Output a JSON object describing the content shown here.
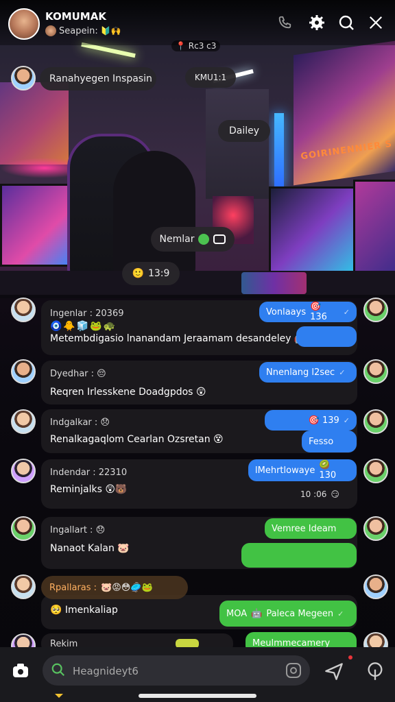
{
  "header": {
    "title": "KOMUMAK",
    "subtitle": "Seapein:",
    "subtitle_emojis": "🔰🙌",
    "phone_icon": "phone-icon",
    "gear_icon": "gear-icon",
    "search_icon": "search-icon",
    "close_icon": "close-icon"
  },
  "top_chip": "📍 Rc3 c3",
  "overlays": {
    "announce": "Ranahyegen Inspasin",
    "pill_right": "KMU1:1",
    "daley": "Dailey",
    "nemlar": "Nemlar",
    "time_chip": "13:9"
  },
  "poster_title": "GOIRINENNIER S",
  "messages": [
    {
      "name": "Ingenlar : 20369",
      "emoji_row": "🧿🐥🧊🐸🐢",
      "text": "Metembdigasio lnanandam Jeraamam desandeley 🤖🤯",
      "reply": "Vonlaays",
      "reply_meta": "🎯 136"
    },
    {
      "name": "Dyedhar :",
      "name_emoji": "😔",
      "text": "Reqren Irlesskene Doadgpdos 😲",
      "reply": "Nnenlang l2sec"
    },
    {
      "name": "Indgalkar :",
      "name_emoji": "😞",
      "text": "Renalkagaqlom Cearlan Ozsretan 😵",
      "reply_meta": "🎯 139",
      "reply2": "Fesso"
    },
    {
      "name": "Indendar : 22310",
      "text": "Reminjalks 😲🐻",
      "reply": "lMehrtlowaye",
      "reply_meta": "🥝 130",
      "time": "10 :06",
      "time_emoji": "😏"
    },
    {
      "name": "Ingallart :",
      "name_emoji": "😞",
      "text": "Nanaot Kalan 🐷",
      "reply": "Vemree Ideam"
    },
    {
      "name": "Rpallaras :",
      "name_emojis": "🐷😡😳🥏🐸",
      "text": "Imenkaliap",
      "text_emoji": "🥺",
      "reply": "MOA",
      "reply_text": "Paleca Megeen",
      "reply_emoji": "🤖"
    },
    {
      "name": "Rekim",
      "reply": "Meulmmecamery"
    }
  ],
  "input": {
    "placeholder": "Heagnideyt6",
    "camera_icon": "camera-icon",
    "sticker_icon": "sticker-icon",
    "send_icon": "send-icon",
    "mic_icon": "mic-icon"
  }
}
